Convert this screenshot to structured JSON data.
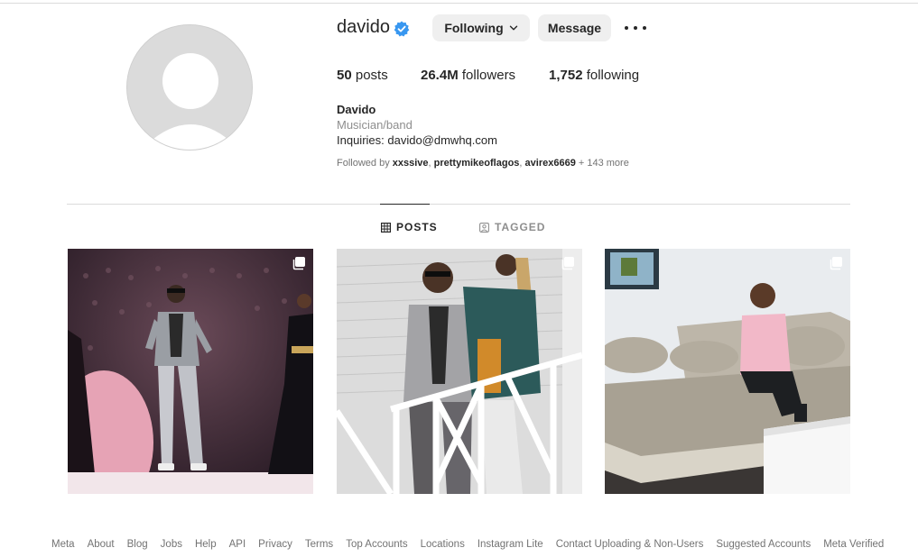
{
  "profile": {
    "username": "davido",
    "following_label": "Following",
    "message_label": "Message",
    "stats": {
      "posts_count": "50",
      "posts_label": "posts",
      "followers_count": "26.4M",
      "followers_label": "followers",
      "following_count": "1,752",
      "following_label": "following"
    },
    "bio": {
      "name": "Davido",
      "category": "Musician/band",
      "text": "Inquiries: davido@dmwhq.com"
    },
    "followed_by": {
      "prefix": "Followed by ",
      "names": [
        "xxssive",
        "prettymikeoflagos",
        "avirex6669"
      ],
      "suffix": "+ 143 more"
    }
  },
  "tabs": [
    {
      "label": "POSTS",
      "icon": "grid-icon",
      "active": true
    },
    {
      "label": "TAGGED",
      "icon": "tagged-icon",
      "active": false
    }
  ],
  "posts": [
    {
      "icon": "carousel-icon",
      "subject": "performer on stage"
    },
    {
      "icon": "carousel-icon",
      "subject": "two people on white railing"
    },
    {
      "icon": "carousel-icon",
      "subject": "child on sofa"
    }
  ],
  "footer": [
    "Meta",
    "About",
    "Blog",
    "Jobs",
    "Help",
    "API",
    "Privacy",
    "Terms",
    "Top Accounts",
    "Locations",
    "Instagram Lite",
    "Contact Uploading & Non-Users",
    "Suggested Accounts",
    "Meta Verified"
  ],
  "colors": {
    "verified": "#3897f0",
    "button_bg": "#efefef",
    "muted_text": "#737373"
  }
}
